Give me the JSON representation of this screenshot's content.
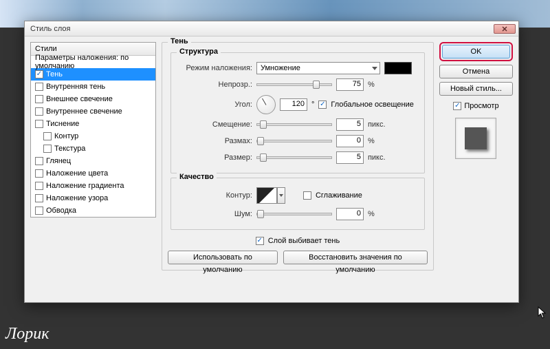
{
  "window": {
    "title": "Стиль слоя"
  },
  "styles_panel": {
    "header": "Стили",
    "blending_row": "Параметры наложения: по умолчанию",
    "items": [
      {
        "label": "Тень",
        "checked": true,
        "selected": true
      },
      {
        "label": "Внутренняя тень",
        "checked": false
      },
      {
        "label": "Внешнее свечение",
        "checked": false
      },
      {
        "label": "Внутреннее свечение",
        "checked": false
      },
      {
        "label": "Тиснение",
        "checked": false
      },
      {
        "label": "Контур",
        "checked": false,
        "indent": true
      },
      {
        "label": "Текстура",
        "checked": false,
        "indent": true
      },
      {
        "label": "Глянец",
        "checked": false
      },
      {
        "label": "Наложение цвета",
        "checked": false
      },
      {
        "label": "Наложение градиента",
        "checked": false
      },
      {
        "label": "Наложение узора",
        "checked": false
      },
      {
        "label": "Обводка",
        "checked": false
      }
    ]
  },
  "main": {
    "title": "Тень",
    "structure": {
      "legend": "Структура",
      "blend_mode_label": "Режим наложения:",
      "blend_mode_value": "Умножение",
      "opacity_label": "Непрозр.:",
      "opacity_value": "75",
      "opacity_unit": "%",
      "angle_label": "Угол:",
      "angle_value": "120",
      "angle_unit": "°",
      "global_light_label": "Глобальное освещение",
      "global_light_checked": true,
      "distance_label": "Смещение:",
      "distance_value": "5",
      "distance_unit": "пикс.",
      "spread_label": "Размах:",
      "spread_value": "0",
      "spread_unit": "%",
      "size_label": "Размер:",
      "size_value": "5",
      "size_unit": "пикс."
    },
    "quality": {
      "legend": "Качество",
      "contour_label": "Контур:",
      "antialias_label": "Сглаживание",
      "antialias_checked": false,
      "noise_label": "Шум:",
      "noise_value": "0",
      "noise_unit": "%"
    },
    "knockout_label": "Слой выбивает тень",
    "knockout_checked": true,
    "use_default_btn": "Использовать по умолчанию",
    "reset_default_btn": "Восстановить значения по умолчанию"
  },
  "buttons": {
    "ok": "OK",
    "cancel": "Отмена",
    "new_style": "Новый стиль...",
    "preview": "Просмотр"
  },
  "watermark": "Лорик"
}
